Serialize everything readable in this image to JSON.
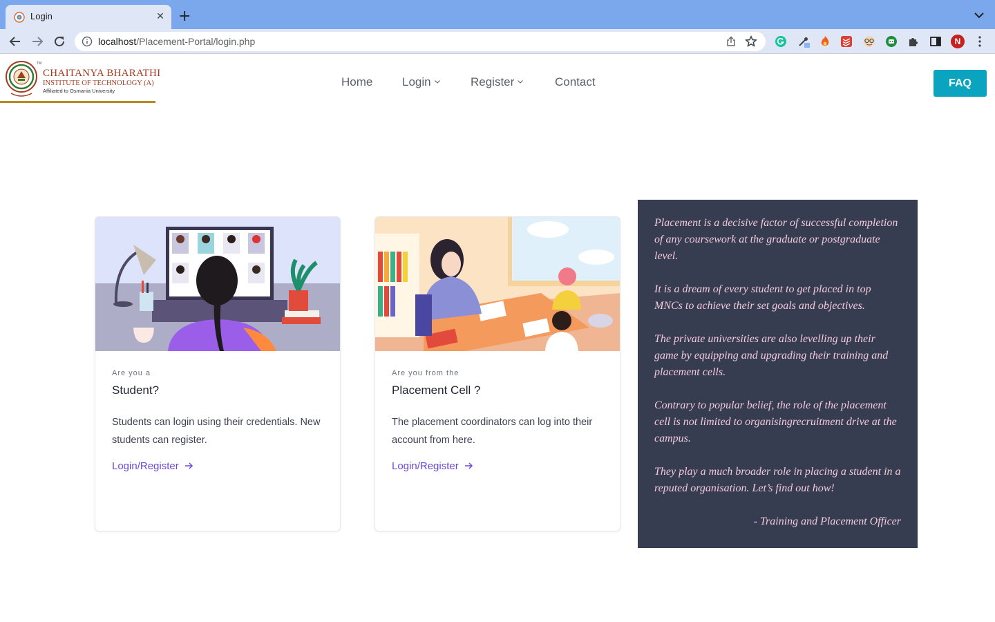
{
  "browser": {
    "tab_title": "Login",
    "tab_close": "✕",
    "new_tab": "+",
    "url_host": "localhost",
    "url_path": "/Placement-Portal/login.php",
    "profile_initial": "N",
    "accent": "#7ba7ec"
  },
  "header": {
    "logo_line1": "CHAITANYA BHARATHI",
    "logo_line2": "INSTITUTE OF TECHNOLOGY (A)",
    "logo_line3": "Affiliated to Osmania University",
    "logo_tm": "TM",
    "nav": {
      "home": "Home",
      "login": "Login",
      "register": "Register",
      "contact": "Contact"
    },
    "faq_label": "FAQ",
    "faq_color": "#0aa3c0"
  },
  "cards": [
    {
      "eyebrow": "Are you a",
      "title": "Student?",
      "text": "Students can login using their credentials. New students can register.",
      "link": "Login/Register"
    },
    {
      "eyebrow": "Are you from the",
      "title": "Placement Cell ?",
      "text": "The placement coordinators can log into their account from here.",
      "link": "Login/Register"
    }
  ],
  "quote": {
    "paragraphs": [
      "Placement is a decisive factor of successful completion of any coursework at the graduate or postgraduate level.",
      "It is a dream of every student to get placed in top MNCs to achieve their set goals and objectives.",
      "The private universities are also levelling up their game by equipping and upgrading their training and placement cells.",
      "Contrary to popular belief, the role of the placement cell is not limited to organisingrecruitment drive at the campus.",
      "They play a much broader role in placing a student in a reputed organisation. Let’s find out how!"
    ],
    "signature": "- Training and Placement Officer",
    "background": "#373d50",
    "text_color": "#f3c9dd"
  }
}
